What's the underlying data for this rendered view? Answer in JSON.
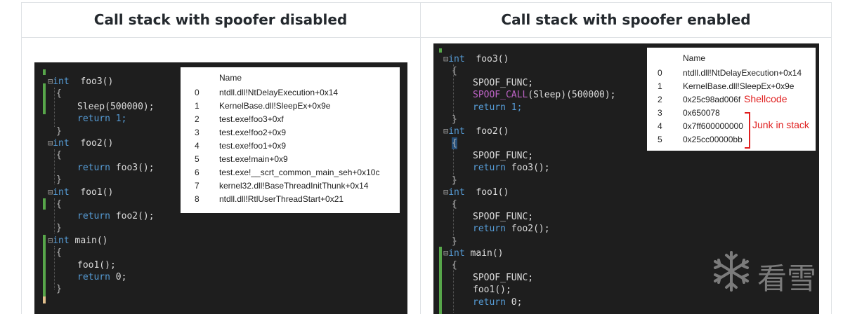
{
  "headers": {
    "left": "Call stack with spoofer disabled",
    "right": "Call stack with spoofer enabled"
  },
  "colors": {
    "editor_bg": "#1e1e1e",
    "keyword": "#569cd6",
    "macro": "#bd63c5",
    "change_bar_green": "#57a64a",
    "annotation_red": "#e02020"
  },
  "left_code": {
    "foo3_sig": "foo3()",
    "sleep_call": "Sleep(500000);",
    "return1": "return 1;",
    "foo2_sig": "foo2()",
    "return_foo3": "return foo3();",
    "foo1_sig": "foo1()",
    "return_foo2": "return foo2();",
    "main_sig": "main()",
    "foo1_call": "foo1();",
    "return0": "return 0;",
    "int_kw": "int",
    "fold_marker": "⊟",
    "open_brace": "{",
    "close_brace": "}"
  },
  "right_code": {
    "foo3_sig": "foo3()",
    "spoof_func": "SPOOF_FUNC;",
    "spoof_call_macro": "SPOOF_CALL",
    "spoof_call_args": "(Sleep)(500000);",
    "return1": "return 1;",
    "foo2_sig": "foo2()",
    "return_foo3": "return foo3();",
    "foo1_sig": "foo1()",
    "return_foo2": "return foo2();",
    "main_sig": "main()",
    "foo1_call": "foo1();",
    "return0": "return 0;",
    "int_kw": "int"
  },
  "left_stack": {
    "header": "Name",
    "rows": [
      {
        "idx": "0",
        "name": "ntdll.dll!NtDelayExecution+0x14"
      },
      {
        "idx": "1",
        "name": "KernelBase.dll!SleepEx+0x9e"
      },
      {
        "idx": "2",
        "name": "test.exe!foo3+0xf"
      },
      {
        "idx": "3",
        "name": "test.exe!foo2+0x9"
      },
      {
        "idx": "4",
        "name": "test.exe!foo1+0x9"
      },
      {
        "idx": "5",
        "name": "test.exe!main+0x9"
      },
      {
        "idx": "6",
        "name": "test.exe!__scrt_common_main_seh+0x10c"
      },
      {
        "idx": "7",
        "name": "kernel32.dll!BaseThreadInitThunk+0x14"
      },
      {
        "idx": "8",
        "name": "ntdll.dll!RtlUserThreadStart+0x21"
      }
    ]
  },
  "right_stack": {
    "header": "Name",
    "rows": [
      {
        "idx": "0",
        "name": "ntdll.dll!NtDelayExecution+0x14"
      },
      {
        "idx": "1",
        "name": "KernelBase.dll!SleepEx+0x9e"
      },
      {
        "idx": "2",
        "name": "0x25c98ad006f"
      },
      {
        "idx": "3",
        "name": "0x650078"
      },
      {
        "idx": "4",
        "name": "0x7ff600000000"
      },
      {
        "idx": "5",
        "name": "0x25cc00000bb"
      }
    ],
    "shellcode_label": "Shellcode",
    "junk_label": "Junk in stack"
  },
  "watermark": {
    "text": "看雪",
    "icon": "snowflake-icon"
  }
}
